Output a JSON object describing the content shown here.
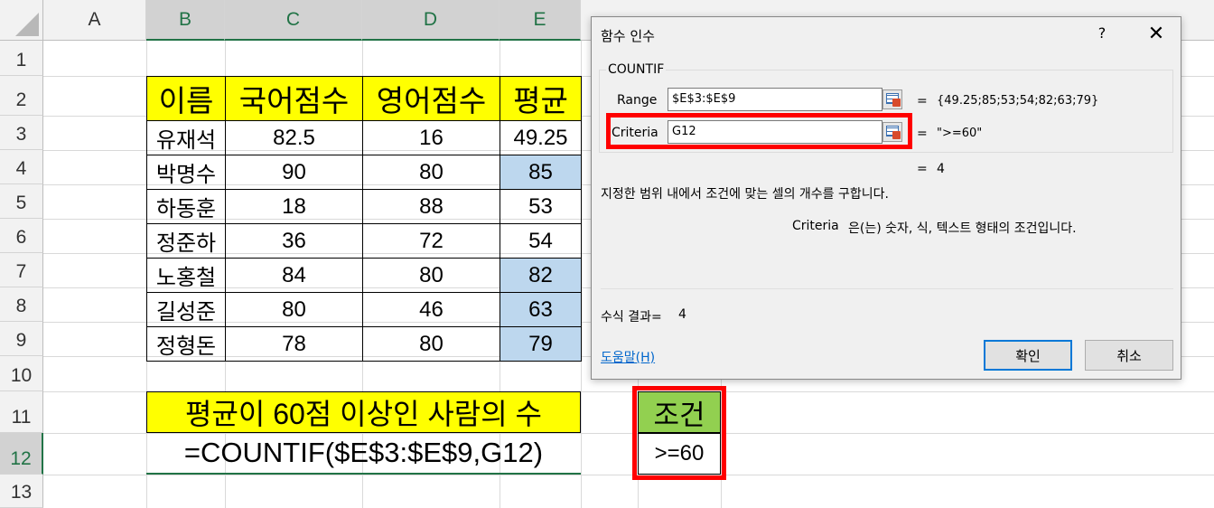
{
  "columns": [
    "A",
    "B",
    "C",
    "D",
    "E"
  ],
  "rows": [
    "1",
    "2",
    "3",
    "4",
    "5",
    "6",
    "7",
    "8",
    "9",
    "10",
    "11",
    "12",
    "13"
  ],
  "table": {
    "headers": [
      "이름",
      "국어점수",
      "영어점수",
      "평균"
    ],
    "rows": [
      {
        "name": "유재석",
        "kor": "82.5",
        "eng": "16",
        "avg": "49.25",
        "highlight": false
      },
      {
        "name": "박명수",
        "kor": "90",
        "eng": "80",
        "avg": "85",
        "highlight": true
      },
      {
        "name": "하동훈",
        "kor": "18",
        "eng": "88",
        "avg": "53",
        "highlight": false
      },
      {
        "name": "정준하",
        "kor": "36",
        "eng": "72",
        "avg": "54",
        "highlight": false
      },
      {
        "name": "노홍철",
        "kor": "84",
        "eng": "80",
        "avg": "82",
        "highlight": true
      },
      {
        "name": "길성준",
        "kor": "80",
        "eng": "46",
        "avg": "63",
        "highlight": true
      },
      {
        "name": "정형돈",
        "kor": "78",
        "eng": "80",
        "avg": "79",
        "highlight": true
      }
    ]
  },
  "banner": "평균이 60점 이상인 사람의 수",
  "formula": "=COUNTIF($E$3:$E$9,G12)",
  "condition": {
    "header": "조건",
    "value": ">=60"
  },
  "dialog": {
    "title": "함수 인수",
    "help": "?",
    "close": "✕",
    "function_name": "COUNTIF",
    "range_label": "Range",
    "range_value": "$E$3:$E$9",
    "range_result": "{49.25;85;53;54;82;63;79}",
    "criteria_label": "Criteria",
    "criteria_value": "G12",
    "criteria_result": "\">=60\"",
    "eq": "=",
    "total_result": "4",
    "description": "지정한 범위 내에서 조건에 맞는 셀의 개수를 구합니다.",
    "arg_name": "Criteria",
    "arg_description": "은(는) 숫자, 식, 텍스트 형태의 조건입니다.",
    "formula_result_label": "수식 결과=",
    "formula_result_value": "4",
    "help_link": "도움말(H)",
    "ok": "확인",
    "cancel": "취소"
  },
  "colors": {
    "yellow": "#ffff00",
    "blue_cell": "#bdd7ee",
    "green_header": "#92d050",
    "red_frame": "#ff0000",
    "excel_green": "#217346"
  }
}
